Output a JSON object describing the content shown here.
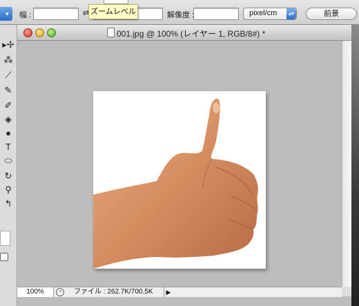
{
  "options_bar": {
    "width_label": "幅 :",
    "resolution_label": "解像度 :",
    "units_select": "pixel/cm",
    "front_button": "前景",
    "tooltip": "ズームレベル"
  },
  "document": {
    "title": "001.jpg @ 100% (レイヤー 1, RGB/8#) *",
    "zoom": "100%",
    "file_info": "ファイル : 262.7K/700.5K"
  },
  "colors": {
    "hand_skin": "#d9956a",
    "tooltip_bg": "#fefdc5",
    "select_accent": "#2f6fcc"
  }
}
